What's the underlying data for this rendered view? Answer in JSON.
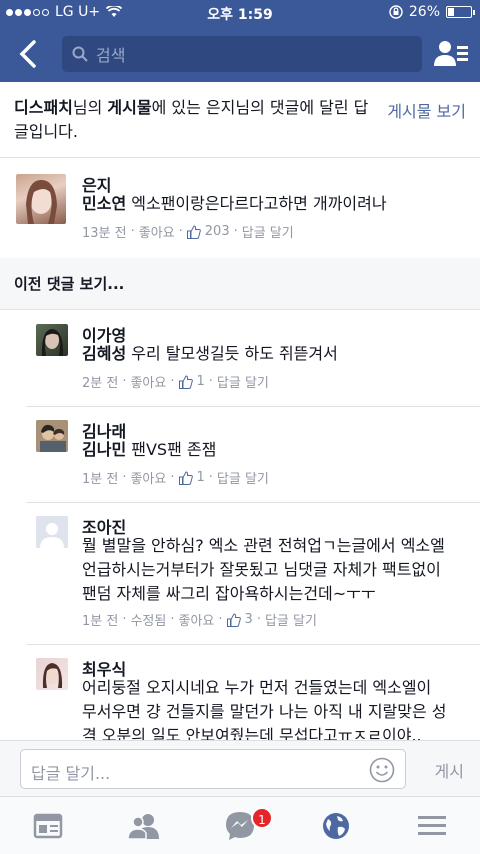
{
  "status": {
    "carrier": "LG U+",
    "time": "오후 1:59",
    "battery": "26%"
  },
  "nav": {
    "search_placeholder": "검색"
  },
  "header": {
    "page_name": "디스패치",
    "text_1": "님의 ",
    "post_word": "게시물",
    "text_2": "에 있는 은지님의 댓글에 달린 답글입니다.",
    "view_post": "게시물 보기"
  },
  "main_comment": {
    "name": "은지",
    "tag": "민소연",
    "text": " 엑소팬이랑은다르다고하면 개까이려나",
    "time": "13분 전",
    "like": "좋아요",
    "likes": "203",
    "reply": "답글 달기"
  },
  "prev_label": "이전 댓글 보기...",
  "replies": [
    {
      "name": "이가영",
      "tag": "김혜성",
      "text": " 우리 탈모생길듯 하도 쥐뜯겨서",
      "time": "2분 전",
      "like": "좋아요",
      "likes": "1",
      "reply": "답글 달기"
    },
    {
      "name": "김나래",
      "tag": "김나민",
      "text": " 팬VS팬 존잼",
      "time": "1분 전",
      "like": "좋아요",
      "likes": "1",
      "reply": "답글 달기"
    },
    {
      "name": "조아진",
      "line1": "뭘 별말을 안하심? 엑소 관련 전혀업ㄱ는글에서 엑소엘",
      "line2": "언급하시는거부터가 잘못됬고 님댓글 자체가 팩트없이",
      "line3": "팬덤 자체를 싸그리 잡아욕하시는건데~ㅜㅜ",
      "time": "1분 전",
      "edited": "수정됨",
      "like": "좋아요",
      "likes": "3",
      "reply": "답글 달기"
    },
    {
      "name": "최우식",
      "line1": "어리둥절 오지시네요 누가 먼저 건들였는데 엑소엘이",
      "line2": "무서우면 걍 건들지를 말던가 나는 아직 내 지랄맞은 성",
      "line3": "격 오분의 일도 안보여줬는데 무섭다고ㅠㅈㄹ이야.."
    }
  ],
  "reply_bar": {
    "placeholder": "답글 달기...",
    "post": "게시"
  },
  "tabbar": {
    "messenger_badge": "1"
  },
  "colors": {
    "brand": "#3b5998",
    "link": "#4e69a2",
    "meta": "#9197a3"
  }
}
